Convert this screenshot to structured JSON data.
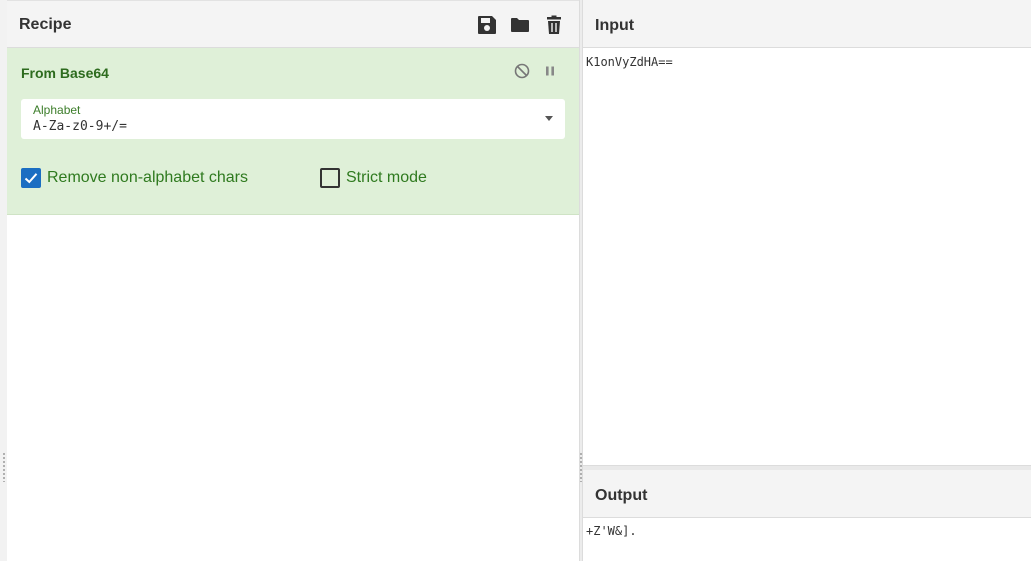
{
  "recipe": {
    "title": "Recipe",
    "header_icons": [
      "save-icon",
      "folder-icon",
      "trash-icon"
    ],
    "operation": {
      "name": "From Base64",
      "controls": [
        "disable-icon",
        "pause-icon"
      ],
      "alphabet": {
        "label": "Alphabet",
        "value": "A-Za-z0-9+/="
      },
      "remove_non_alphabet": {
        "label": "Remove non-alphabet chars",
        "checked": true
      },
      "strict_mode": {
        "label": "Strict mode",
        "checked": false
      }
    }
  },
  "input": {
    "title": "Input",
    "text": "K1onVyZdHA=="
  },
  "output": {
    "title": "Output",
    "text": "+Z'W&]."
  },
  "colors": {
    "operation_bg": "#dff0d8",
    "operation_text": "#2d6b1e",
    "checkbox_checked": "#1b6ec2",
    "header_bg": "#f4f4f4"
  }
}
